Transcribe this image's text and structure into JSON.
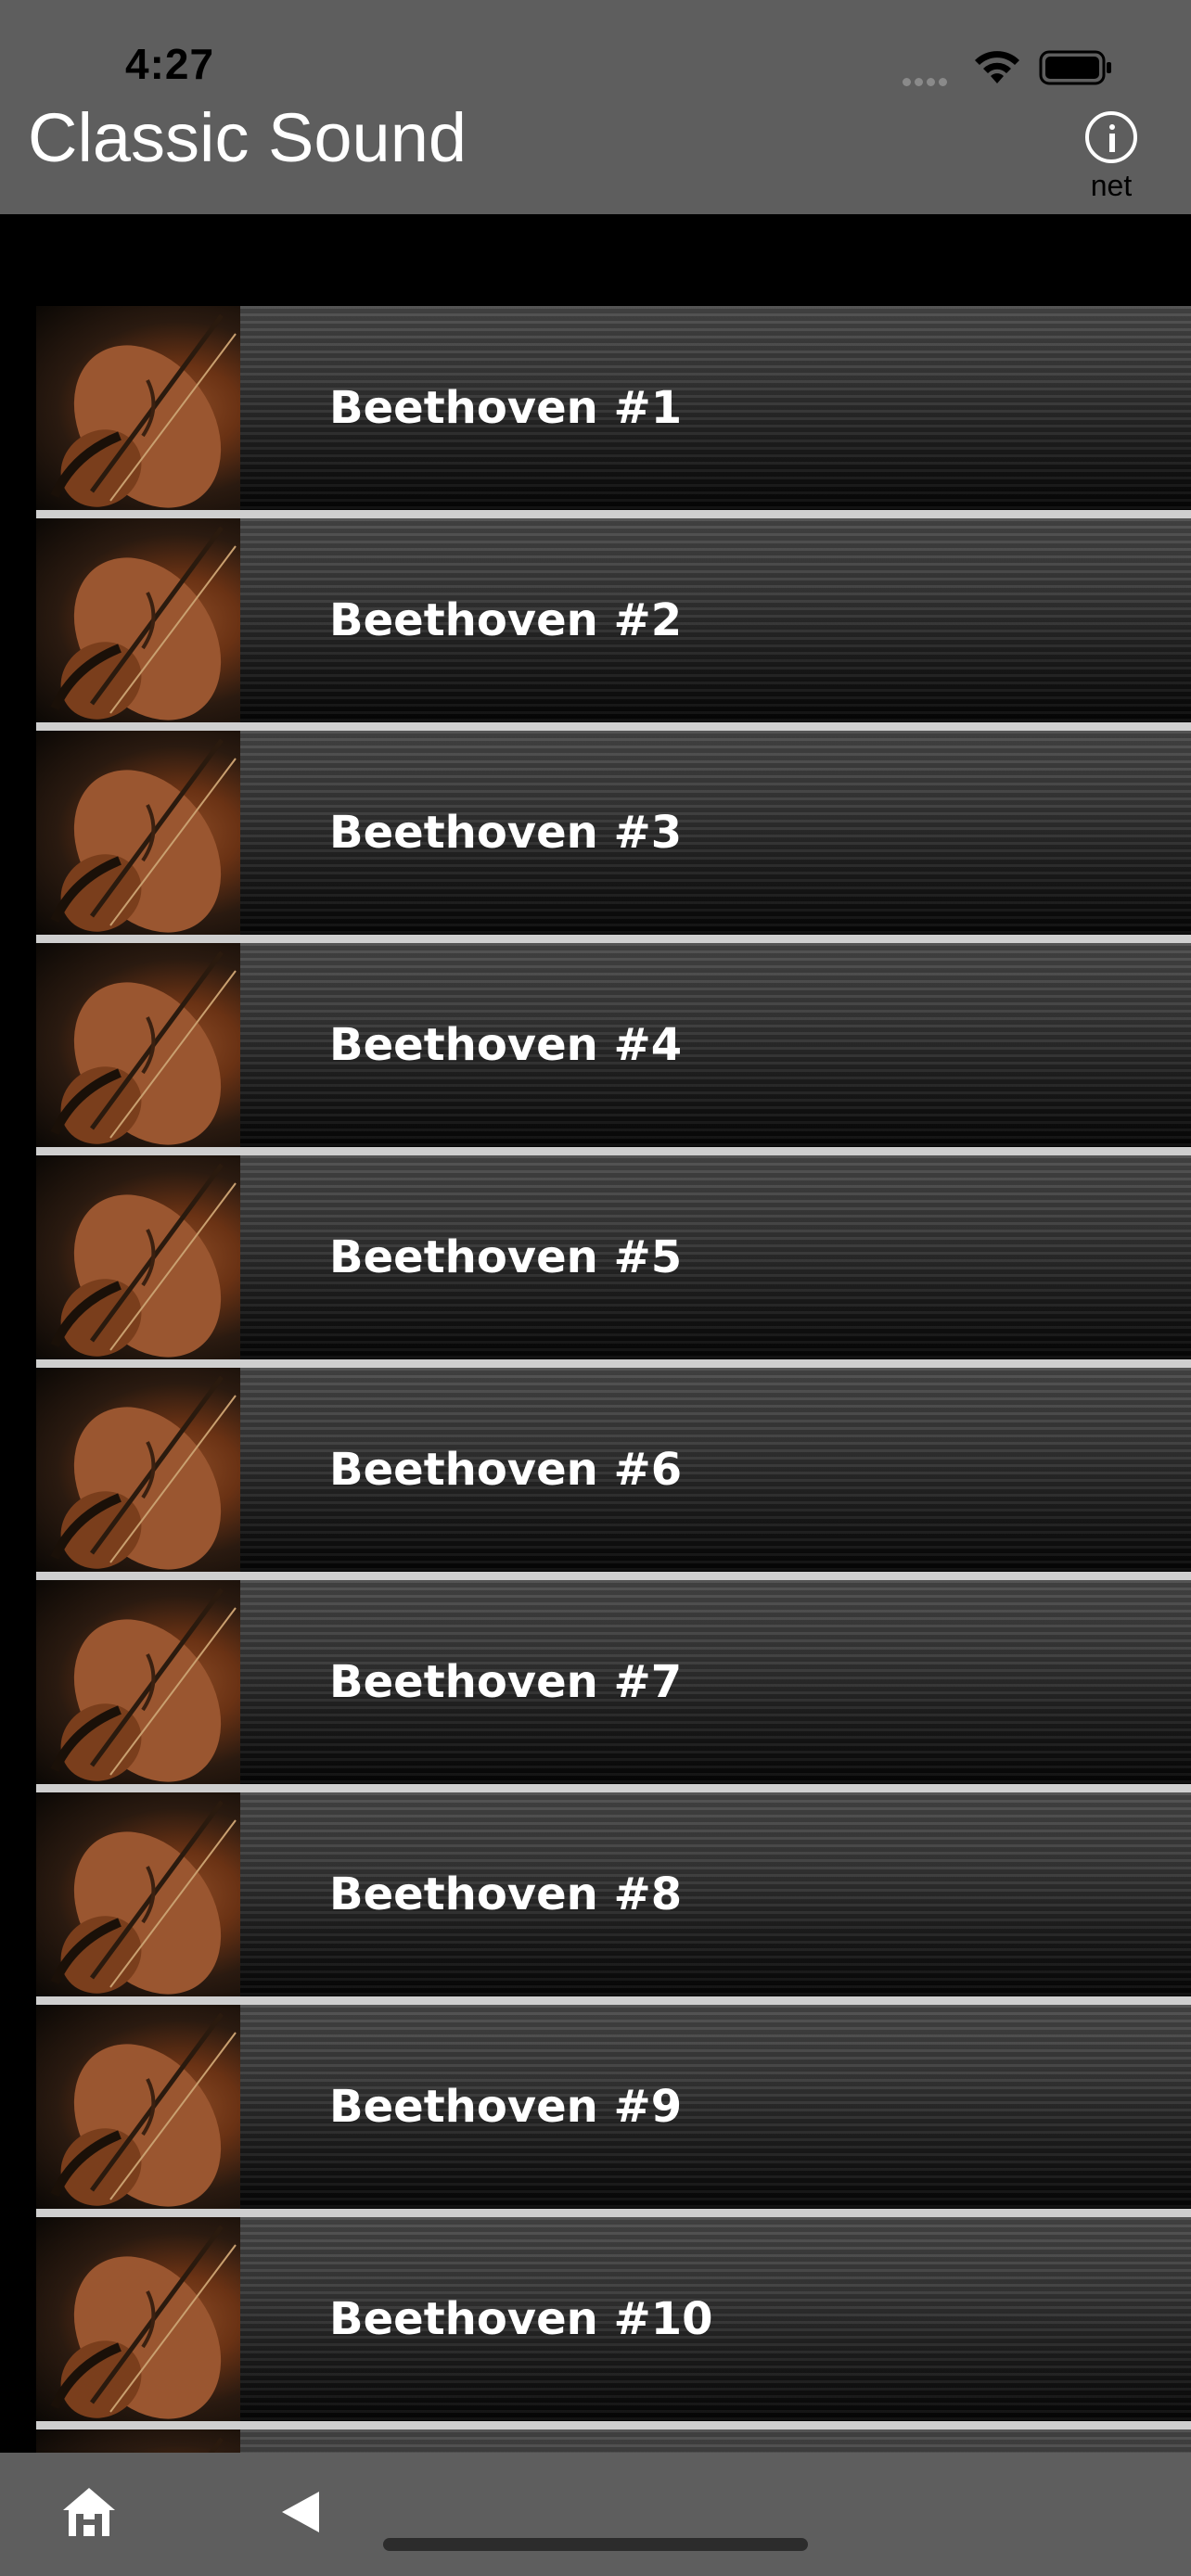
{
  "status_bar": {
    "time": "4:27"
  },
  "header": {
    "title": "Classic Sound",
    "info_label": "net"
  },
  "list": {
    "items": [
      {
        "label": "Beethoven #1"
      },
      {
        "label": "Beethoven #2"
      },
      {
        "label": "Beethoven #3"
      },
      {
        "label": "Beethoven #4"
      },
      {
        "label": "Beethoven #5"
      },
      {
        "label": "Beethoven #6"
      },
      {
        "label": "Beethoven #7"
      },
      {
        "label": "Beethoven #8"
      },
      {
        "label": "Beethoven #9"
      },
      {
        "label": "Beethoven #10"
      },
      {
        "label": ""
      }
    ]
  },
  "toolbar": {
    "icons": [
      "home-icon",
      "back-icon"
    ]
  },
  "colors": {
    "bar_bg": "#5e5e5e",
    "text": "#ffffff"
  }
}
